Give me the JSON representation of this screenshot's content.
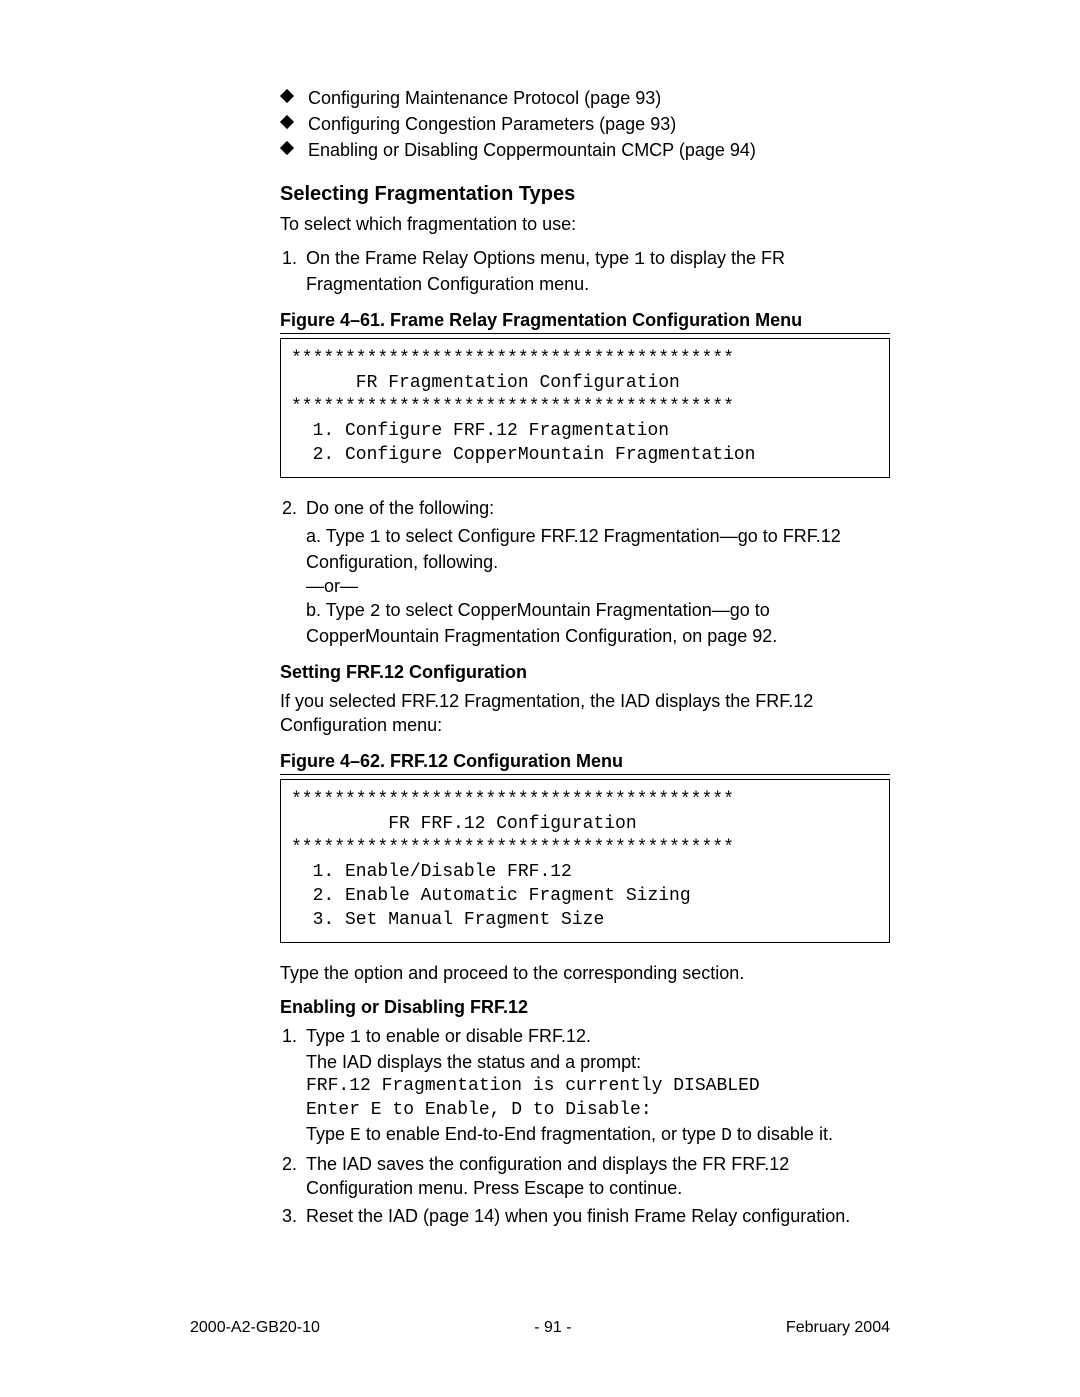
{
  "bullets": [
    "Configuring Maintenance Protocol (page 93)",
    "Configuring Congestion Parameters (page 93)",
    "Enabling or Disabling Coppermountain CMCP (page 94)"
  ],
  "section_heading": "Selecting Fragmentation Types",
  "intro_line": "To select which fragmentation to use:",
  "step1_a": "On the Frame Relay Options menu, type ",
  "step1_code": "1",
  "step1_b": " to display the FR Fragmentation Configuration menu.",
  "fig61_caption": "Figure 4–61.  Frame Relay Fragmentation Configuration Menu",
  "fig61_box": "*****************************************\n      FR Fragmentation Configuration\n*****************************************\n  1. Configure FRF.12 Fragmentation\n  2. Configure CopperMountain Fragmentation",
  "step2_lead": "Do one of the following:",
  "step2a_a": "a. Type ",
  "step2a_code": "1",
  "step2a_b": " to select Configure FRF.12 Fragmentation—go to FRF.12 Configuration, following.",
  "step2_or": "—or—",
  "step2b_a": "b. Type ",
  "step2b_code": "2",
  "step2b_b": " to select CopperMountain Fragmentation—go to CopperMountain Fragmentation Configuration, on page 92.",
  "sub_frf12": "Setting FRF.12 Configuration",
  "frf12_intro": "If you selected FRF.12 Fragmentation, the IAD displays the FRF.12 Configuration menu:",
  "fig62_caption": "Figure 4–62.  FRF.12 Configuration Menu",
  "fig62_box": "*****************************************\n         FR FRF.12 Configuration\n*****************************************\n  1. Enable/Disable FRF.12\n  2. Enable Automatic Fragment Sizing\n  3. Set Manual Fragment Size",
  "after_fig62": "Type the option and proceed to the corresponding section.",
  "sub_enable": "Enabling or Disabling FRF.12",
  "en_step1_a": "Type ",
  "en_step1_code": "1",
  "en_step1_b": " to enable or disable FRF.12.",
  "en_step1_line2": "The IAD displays the status and a prompt:",
  "en_step1_mono1": "FRF.12 Fragmentation is currently DISABLED",
  "en_step1_mono2": "Enter E to Enable, D to Disable:",
  "en_step1_last_a": "Type ",
  "en_step1_last_code1": "E",
  "en_step1_last_mid": " to enable End-to-End fragmentation, or type ",
  "en_step1_last_code2": "D",
  "en_step1_last_b": " to disable it.",
  "en_step2": "The IAD saves the configuration and displays the FR FRF.12 Configuration menu. Press Escape to continue.",
  "en_step3": "Reset the IAD (page 14) when you finish Frame Relay configuration.",
  "footer_left": "2000-A2-GB20-10",
  "footer_center": "- 91 -",
  "footer_right": "February 2004"
}
